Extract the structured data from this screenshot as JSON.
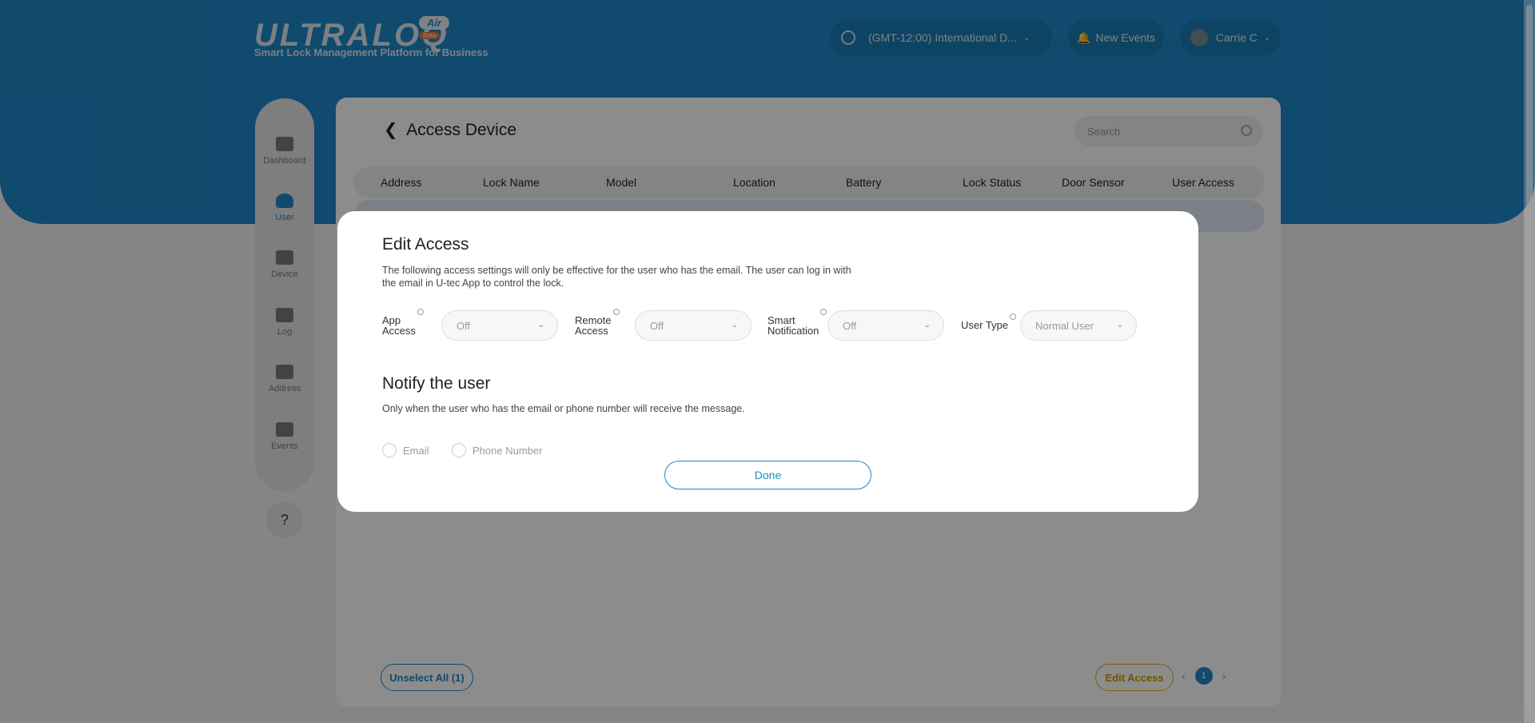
{
  "header": {
    "logo_text": "ULTRALOQ",
    "logo_badge": "Air",
    "logo_beta": "Beta",
    "subtitle": "Smart Lock Management Platform for Business",
    "timezone": "(GMT-12:00) International D...",
    "events_label": "New Events",
    "user_name": "Carrie C"
  },
  "sidebar": {
    "items": [
      {
        "label": "Dashboard"
      },
      {
        "label": "User"
      },
      {
        "label": "Device"
      },
      {
        "label": "Log"
      },
      {
        "label": "Address"
      },
      {
        "label": "Events"
      }
    ],
    "help_label": "?"
  },
  "main": {
    "title": "Access Device",
    "search_placeholder": "Search",
    "columns": [
      "Address",
      "Lock Name",
      "Model",
      "Location",
      "Battery",
      "Lock Status",
      "Door Sensor",
      "User Access"
    ],
    "unselect_label": "Unselect All (1)",
    "edit_access_label": "Edit Access",
    "page": "1"
  },
  "modal": {
    "title": "Edit Access",
    "description": "The following access settings will only be effective for the user who has the email. The user can log in with the email in U-tec App to control the lock.",
    "fields": [
      {
        "label_line1": "App",
        "label_line2": "Access",
        "value": "Off"
      },
      {
        "label_line1": "Remote",
        "label_line2": "Access",
        "value": "Off"
      },
      {
        "label_line1": "Smart",
        "label_line2": "Notification",
        "value": "Off"
      },
      {
        "label_line1": "User Type",
        "label_line2": "",
        "value": "Normal User"
      }
    ],
    "notify_title": "Notify the user",
    "notify_description": "Only when the user who has the email or phone number will receive the message.",
    "email_label": "Email",
    "phone_label": "Phone Number",
    "done_label": "Done"
  }
}
